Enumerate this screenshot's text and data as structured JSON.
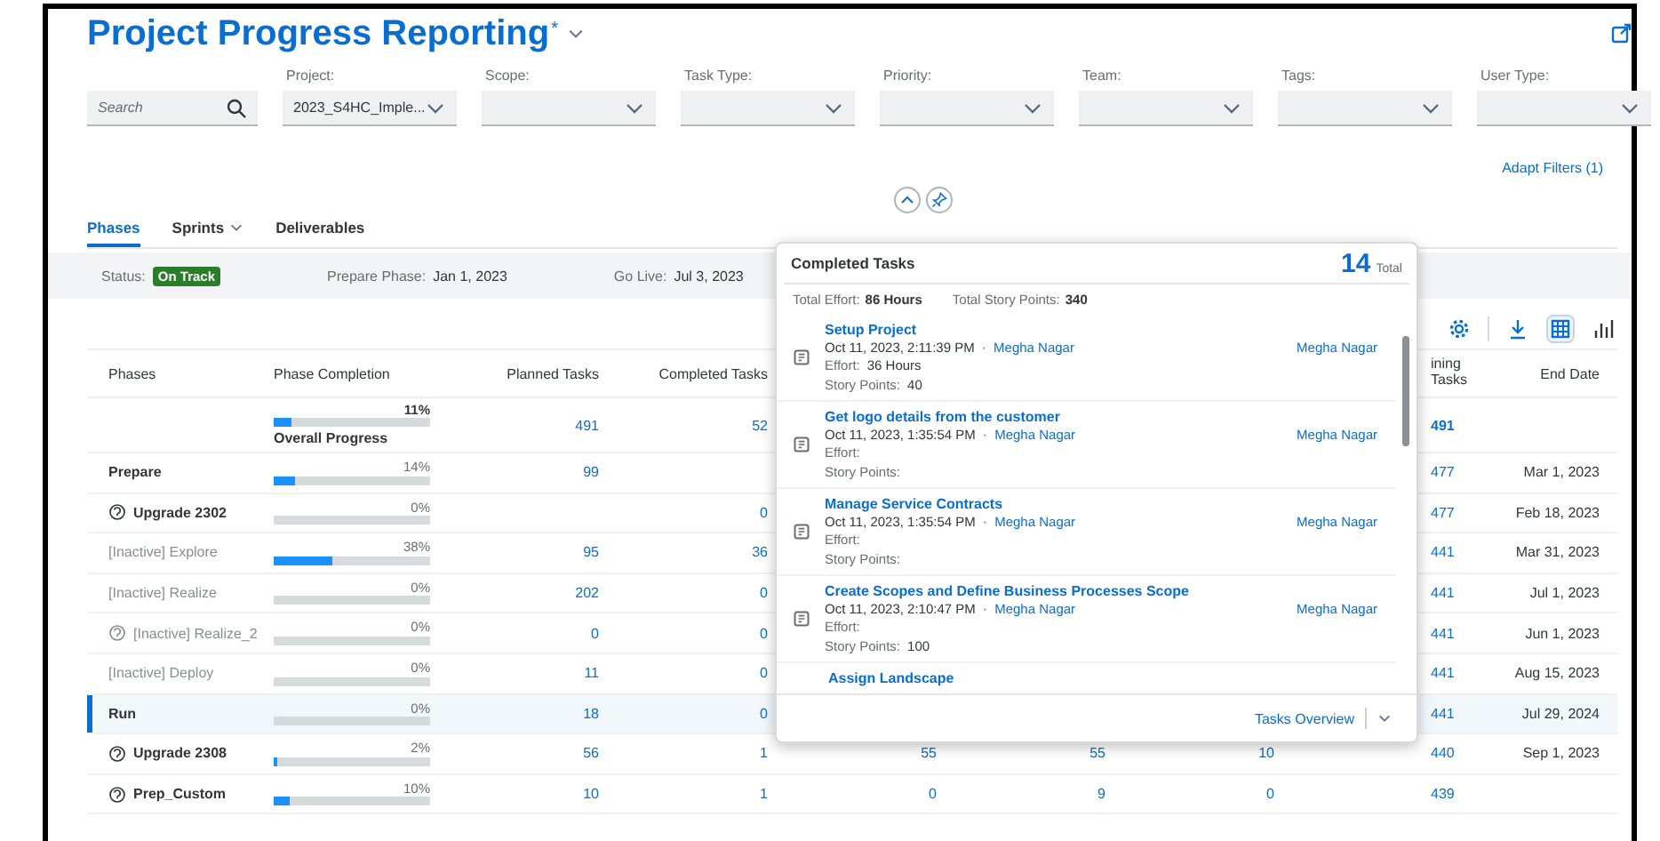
{
  "header": {
    "title": "Project Progress Reporting",
    "modified_mark": "*"
  },
  "filters": {
    "search": {
      "placeholder": "Search"
    },
    "fields": [
      {
        "label": "Project:",
        "value": "2023_S4HC_Imple..."
      },
      {
        "label": "Scope:"
      },
      {
        "label": "Task Type:"
      },
      {
        "label": "Priority:"
      },
      {
        "label": "Team:"
      },
      {
        "label": "Tags:"
      },
      {
        "label": "User Type:"
      }
    ],
    "adapt_link": "Adapt Filters (1)"
  },
  "tabs": [
    {
      "label": "Phases",
      "selected": true,
      "dropdown": false
    },
    {
      "label": "Sprints",
      "selected": false,
      "dropdown": true
    },
    {
      "label": "Deliverables",
      "selected": false,
      "dropdown": false
    }
  ],
  "status": {
    "label": "Status:",
    "badge": "On Track",
    "prepare_label": "Prepare Phase:",
    "prepare_date": "Jan 1, 2023",
    "golive_label": "Go Live:",
    "golive_date": "Jul 3, 2023"
  },
  "toolbar": [
    {
      "kind": "settings",
      "selected": false
    },
    {
      "kind": "download",
      "selected": false
    },
    {
      "kind": "table",
      "selected": true
    },
    {
      "kind": "chart",
      "selected": false
    }
  ],
  "table": {
    "columns": {
      "phases": "Phases",
      "completion": "Phase Completion",
      "planned": "Planned Tasks",
      "completed": "Completed Tasks",
      "remaining": "ining Tasks",
      "end_date": "End Date"
    },
    "rows": [
      {
        "kind": "overall",
        "percent": "11%",
        "level": 0.11,
        "caption": "Overall Progress",
        "planned": "491",
        "completed": "52",
        "remaining": "491",
        "selected": false
      },
      {
        "kind": "phase",
        "name": "Prepare",
        "percent": "14%",
        "level": 0.14,
        "planned": "99",
        "remaining": "477",
        "end_date": "Mar 1, 2023",
        "selected": false
      },
      {
        "kind": "sprint",
        "name": "Upgrade 2302",
        "percent": "0%",
        "level": 0,
        "completed": "0",
        "remaining": "477",
        "end_date": "Feb 18, 2023",
        "selected": false
      },
      {
        "kind": "inactive",
        "name": "[Inactive] Explore",
        "percent": "38%",
        "level": 0.38,
        "planned": "95",
        "completed": "36",
        "remaining": "441",
        "end_date": "Mar 31, 2023",
        "selected": false
      },
      {
        "kind": "inactive",
        "name": "[Inactive] Realize",
        "percent": "0%",
        "level": 0,
        "planned": "202",
        "completed": "0",
        "remaining": "441",
        "end_date": "Jul 1, 2023",
        "selected": false
      },
      {
        "kind": "inactive-sprint",
        "name": "[Inactive] Realize_2",
        "percent": "0%",
        "level": 0,
        "planned": "0",
        "completed": "0",
        "remaining": "441",
        "end_date": "Jun 1, 2023",
        "selected": false
      },
      {
        "kind": "inactive",
        "name": "[Inactive] Deploy",
        "percent": "0%",
        "level": 0,
        "planned": "11",
        "completed": "0",
        "remaining": "441",
        "end_date": "Aug 15, 2023",
        "selected": false
      },
      {
        "kind": "phase",
        "name": "Run",
        "percent": "0%",
        "level": 0,
        "planned": "18",
        "completed": "0",
        "remaining": "441",
        "end_date": "Jul 29, 2024",
        "selected": true
      },
      {
        "kind": "sprint",
        "name": "Upgrade 2308",
        "percent": "2%",
        "level": 0.02,
        "planned": "56",
        "completed": "1",
        "column_5": "55",
        "column_6": "55",
        "column_7": "10",
        "remaining": "440",
        "end_date": "Sep 1, 2023",
        "selected": false
      },
      {
        "kind": "sprint",
        "name": "Prep_Custom",
        "percent": "10%",
        "level": 0.1,
        "planned": "10",
        "completed": "1",
        "column_5": "0",
        "column_6": "9",
        "column_7": "0",
        "remaining": "439",
        "selected": false
      }
    ]
  },
  "popover": {
    "title": "Completed Tasks",
    "count": "14",
    "count_label": "Total",
    "effort_label": "Total Effort:",
    "effort": "86 Hours",
    "points_label": "Total Story Points:",
    "points": "340",
    "tasks": [
      {
        "title": "Setup Project",
        "date": "Oct 11, 2023, 2:11:39 PM",
        "separator": "·",
        "person": "Megha Nagar",
        "assignee": "Megha Nagar",
        "effort_label": "Effort:",
        "effort": "36 Hours",
        "points_label": "Story Points:",
        "points": "40"
      },
      {
        "title": "Get logo details from the customer",
        "date": "Oct 11, 2023, 1:35:54 PM",
        "separator": "·",
        "person": "Megha Nagar",
        "assignee": "Megha Nagar",
        "effort_label": "Effort:",
        "points_label": "Story Points:"
      },
      {
        "title": "Manage Service Contracts",
        "date": "Oct 11, 2023, 1:35:54 PM",
        "separator": "·",
        "person": "Megha Nagar",
        "assignee": "Megha Nagar",
        "effort_label": "Effort:",
        "points_label": "Story Points:"
      },
      {
        "title": "Create Scopes and Define Business Processes Scope",
        "date": "Oct 11, 2023, 2:10:47 PM",
        "separator": "·",
        "person": "Megha Nagar",
        "assignee": "Megha Nagar",
        "effort_label": "Effort:",
        "points_label": "Story Points:",
        "points": "100"
      },
      {
        "title": "Assign Landscape"
      }
    ],
    "footer_link": "Tasks Overview"
  }
}
